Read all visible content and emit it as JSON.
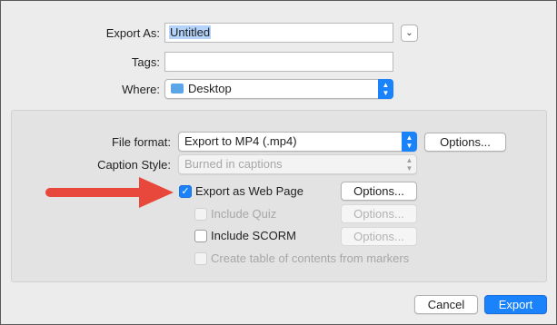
{
  "export_as": {
    "label": "Export As:",
    "value": "Untitled"
  },
  "tags": {
    "label": "Tags:",
    "value": ""
  },
  "where": {
    "label": "Where:",
    "value": "Desktop"
  },
  "file_format": {
    "label": "File format:",
    "value": "Export to MP4 (.mp4)",
    "options_label": "Options..."
  },
  "caption_style": {
    "label": "Caption Style:",
    "value": "Burned in captions"
  },
  "web_page": {
    "label": "Export as Web Page",
    "checked": true,
    "options_label": "Options..."
  },
  "include_quiz": {
    "label": "Include Quiz",
    "checked": false,
    "options_label": "Options..."
  },
  "include_scorm": {
    "label": "Include SCORM",
    "checked": false,
    "options_label": "Options..."
  },
  "toc": {
    "label": "Create table of contents from markers",
    "checked": false
  },
  "footer": {
    "cancel_label": "Cancel",
    "export_label": "Export"
  },
  "colors": {
    "accent": "#1a82fb",
    "arrow": "#e8473b"
  }
}
